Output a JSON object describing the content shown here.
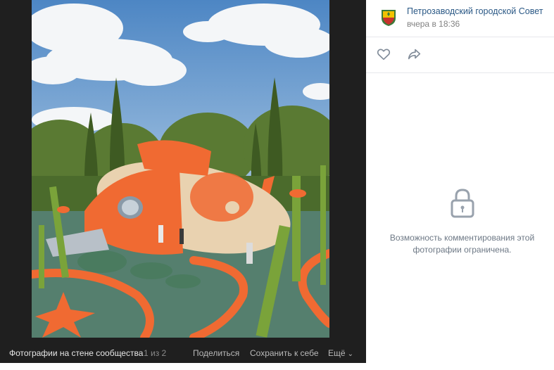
{
  "viewer": {
    "album_label": "Фотографии на стене сообщества",
    "counter": "1 из 2",
    "share_label": "Поделиться",
    "save_label": "Сохранить к себе",
    "more_label": "Ещё"
  },
  "post": {
    "owner_name": "Петрозаводский городской Совет",
    "date": "вчера в 18:36"
  },
  "comments": {
    "restricted_text": "Возможность комментирования этой фотографии ограничена."
  },
  "icons": {
    "like": "heart-icon",
    "repost": "share-arrow-icon",
    "lock": "lock-icon",
    "more": "chevron-down-icon"
  },
  "colors": {
    "viewer_bg": "#1f1f1f",
    "link": "#2a5885",
    "muted": "#828282",
    "icon": "#818c99",
    "fish_orange": "#f06a32",
    "ground": "#557f6e"
  }
}
